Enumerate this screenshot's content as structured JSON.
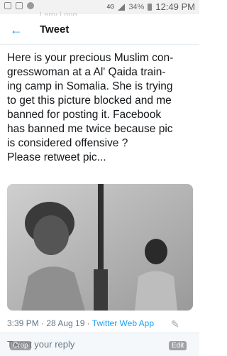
{
  "status_bar": {
    "network": "4G",
    "battery": "34%",
    "time": "12:49 PM"
  },
  "ghost_name": "Larry Long",
  "header": {
    "back_icon": "arrow-left-icon",
    "title": "Tweet"
  },
  "tweet": {
    "text": "Here is your precious Muslim con-\ngresswoman at a Al' Qaida train-\ning camp in Somalia. She is trying\nto get this picture blocked and me\nbanned for posting it. Facebook\nhas banned me twice because pic\nis considered  offensive ?\nPlease retweet pic...",
    "timestamp": "3:39 PM · 28 Aug 19 · ",
    "source": "Twitter Web App"
  },
  "reply": {
    "placeholder": "Tweet your reply"
  },
  "overlay": {
    "left_label": "Crop",
    "right_label": "Edit"
  },
  "colors": {
    "accent": "#1da1f2",
    "text": "#14171a",
    "muted": "#657786"
  }
}
